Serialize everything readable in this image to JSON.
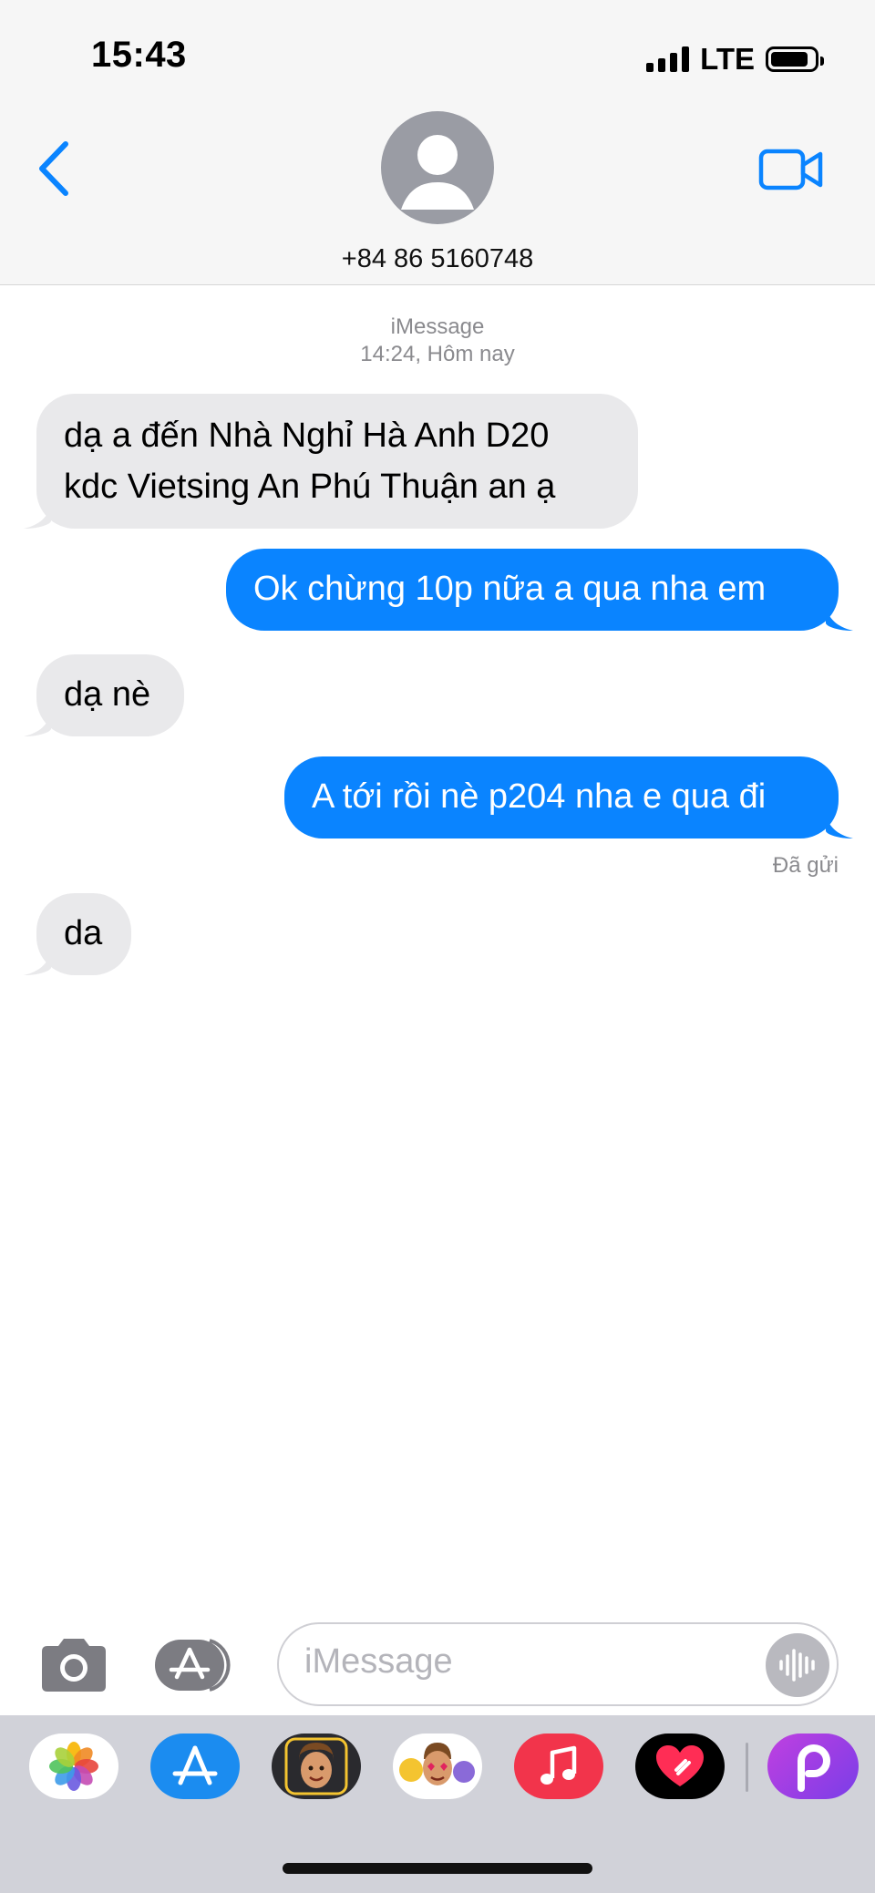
{
  "status_bar": {
    "time": "15:43",
    "network": "LTE"
  },
  "header": {
    "contact": "+84 86 5160748"
  },
  "conversation": {
    "service": "iMessage",
    "timestamp": "14:24, Hôm nay",
    "delivered_label": "Đã gửi",
    "messages": [
      {
        "direction": "incoming",
        "lines": [
          "dạ a đến Nhà Nghỉ Hà Anh D20",
          "kdc Vietsing An Phú Thuận an ạ"
        ]
      },
      {
        "direction": "outgoing",
        "text": "Ok chừng 10p nữa a qua nha em"
      },
      {
        "direction": "incoming",
        "text": "dạ nè"
      },
      {
        "direction": "outgoing",
        "text": "A tới rồi nè p204 nha e qua đi"
      },
      {
        "direction": "incoming",
        "text": "da"
      }
    ]
  },
  "composer": {
    "placeholder": "iMessage"
  },
  "colors": {
    "outgoing_bubble": "#0a84ff",
    "incoming_bubble": "#e9e9eb",
    "accent": "#0a84ff"
  },
  "app_drawer": {
    "apps": [
      {
        "icon": "photos-icon"
      },
      {
        "icon": "app-store-icon"
      },
      {
        "icon": "memoji-icon"
      },
      {
        "icon": "memoji-stickers-icon"
      },
      {
        "icon": "music-icon"
      },
      {
        "icon": "digital-touch-icon"
      },
      {
        "icon": "picsart-icon"
      }
    ]
  }
}
